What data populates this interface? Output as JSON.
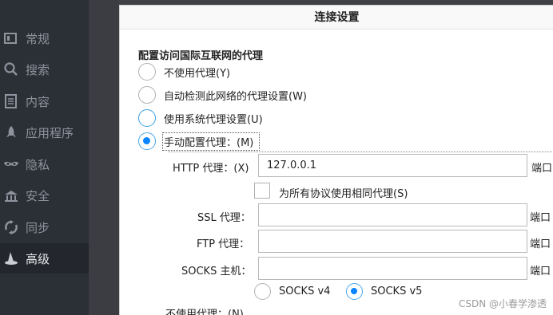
{
  "sidebar": {
    "items": [
      {
        "label": "常规",
        "icon": "general-icon"
      },
      {
        "label": "搜索",
        "icon": "search-icon"
      },
      {
        "label": "内容",
        "icon": "content-icon"
      },
      {
        "label": "应用程序",
        "icon": "rocket-icon"
      },
      {
        "label": "隐私",
        "icon": "mask-icon"
      },
      {
        "label": "安全",
        "icon": "security-icon"
      },
      {
        "label": "同步",
        "icon": "sync-icon"
      },
      {
        "label": "高级",
        "icon": "wizard-hat-icon",
        "active": true
      }
    ]
  },
  "dialog": {
    "title": "连接设置",
    "section_title": "配置访问国际互联网的代理",
    "options": {
      "no_proxy": "不使用代理(Y)",
      "auto_detect": "自动检测此网络的代理设置(W)",
      "system_proxy": "使用系统代理设置(U)",
      "manual_proxy": "手动配置代理：(M)"
    },
    "selected_option": "manual_proxy",
    "http": {
      "label": "HTTP 代理：(X)",
      "value": "127.0.0.1",
      "port_label": "端口"
    },
    "same_proxy_label": "为所有协议使用相同代理(S)",
    "same_proxy_checked": false,
    "ssl": {
      "label": "SSL 代理：",
      "value": "",
      "port_label": "端口"
    },
    "ftp": {
      "label": "FTP 代理：",
      "value": "",
      "port_label": "端口"
    },
    "socks": {
      "label": "SOCKS 主机：",
      "value": "",
      "port_label": "端口"
    },
    "socks_v4": "SOCKS v4",
    "socks_v5": "SOCKS v5",
    "socks_selected": "v5",
    "no_proxy_for": "不使用代理：(N)"
  },
  "watermark": "CSDN @小春学渗透"
}
